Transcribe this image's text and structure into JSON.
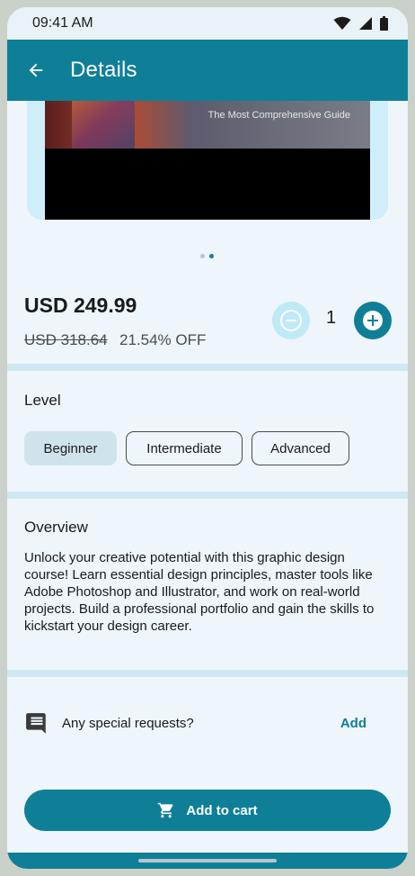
{
  "status_bar": {
    "time": "09:41 AM"
  },
  "app_bar": {
    "title": "Details"
  },
  "cover_image": {
    "caption": "The Most Comprehensive Guide"
  },
  "carousel": {
    "dot_count": 2,
    "active_index": 1
  },
  "pricing": {
    "price": "USD 249.99",
    "original_price": "USD 318.64",
    "discount": "21.54% OFF"
  },
  "quantity": {
    "value": "1"
  },
  "level": {
    "title": "Level",
    "options": [
      "Beginner",
      "Intermediate",
      "Advanced"
    ],
    "selected": "Beginner"
  },
  "overview": {
    "title": "Overview",
    "text": "Unlock your creative potential with this graphic design course! Learn essential design principles, master tools like Adobe Photoshop and Illustrator, and work on real-world projects. Build a professional portfolio and gain the skills to kickstart your design career."
  },
  "special_requests": {
    "label": "Any special requests?",
    "action": "Add"
  },
  "cart": {
    "label": "Add to cart"
  },
  "colors": {
    "primary": "#0f7f98",
    "light_accent": "#bfe9f7",
    "background": "#eef5fb"
  }
}
